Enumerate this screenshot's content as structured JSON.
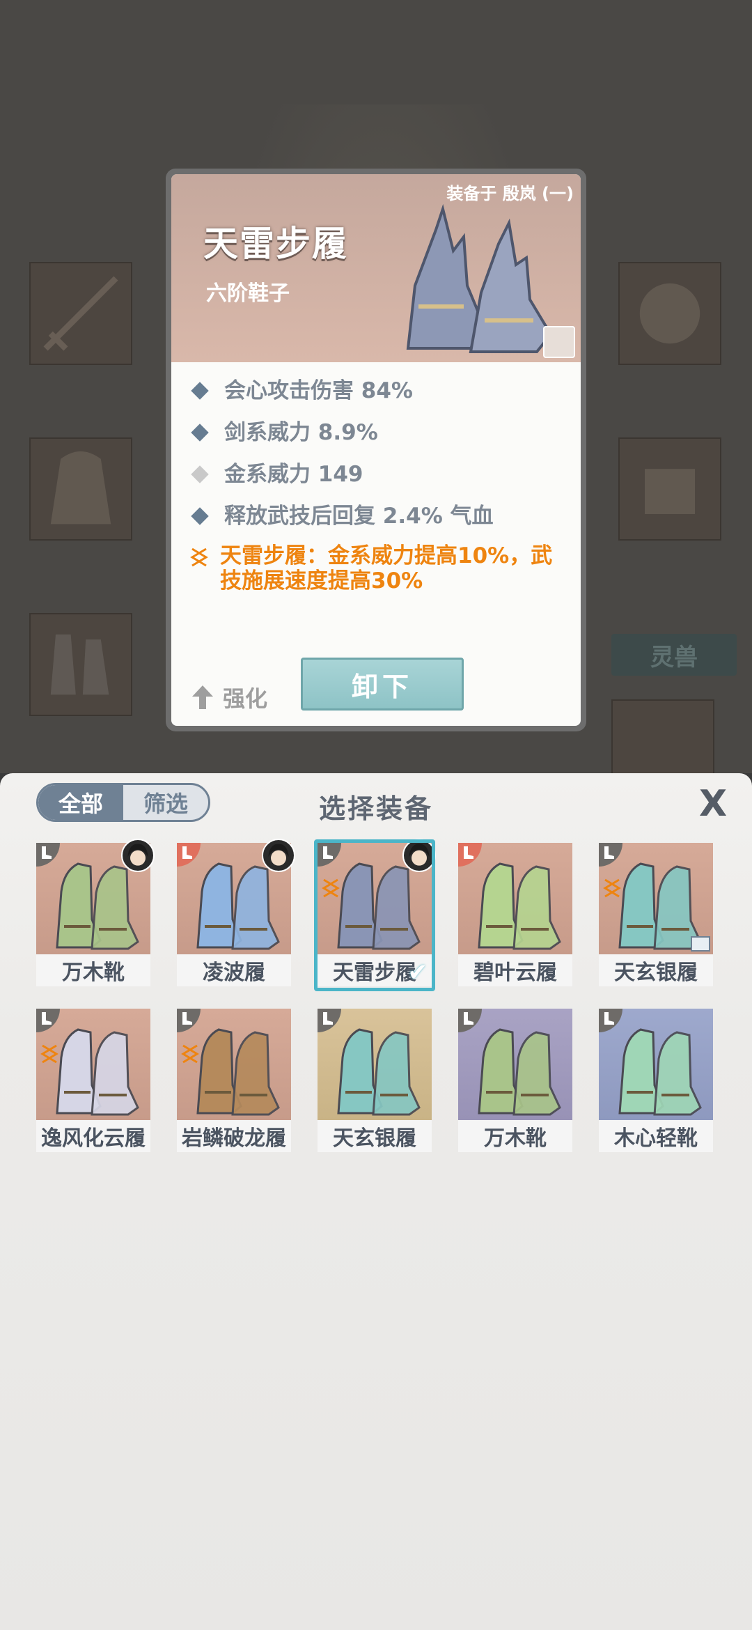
{
  "detail": {
    "equipped_on": "装备于 殷岚 (一)",
    "name": "天雷步履",
    "type": "六阶鞋子",
    "stats": [
      "会心攻击伤害 84%",
      "剑系威力 8.9%",
      "金系威力 149",
      "释放武技后回复 2.4% 气血"
    ],
    "set_bonus_line1": "天雷步履：金系威力提高10%，武",
    "set_bonus_line2": "技施展速度提高30%",
    "enhance_label": "强化",
    "unequip_label": "卸下"
  },
  "background": {
    "pet_tab_label": "灵兽"
  },
  "panel": {
    "filter_all": "全部",
    "filter_screen": "筛选",
    "title": "选择装备",
    "close_label": "X",
    "items": [
      {
        "name": "万木靴",
        "bg": "salmon",
        "color": "#a9c48a",
        "badge": "gray",
        "avatar": true,
        "set": false,
        "tag": false,
        "selected": false
      },
      {
        "name": "凌波履",
        "bg": "salmon",
        "color": "#8fb4e0",
        "badge": "red",
        "avatar": true,
        "set": false,
        "tag": false,
        "selected": false
      },
      {
        "name": "天雷步履",
        "bg": "salmon",
        "color": "#8a95b5",
        "badge": "gray",
        "avatar": true,
        "set": true,
        "tag": false,
        "selected": true
      },
      {
        "name": "碧叶云履",
        "bg": "salmon",
        "color": "#b5d490",
        "badge": "red",
        "avatar": false,
        "set": false,
        "tag": false,
        "selected": false
      },
      {
        "name": "天玄银履",
        "bg": "salmon",
        "color": "#86c7c2",
        "badge": "gray",
        "avatar": false,
        "set": true,
        "tag": true,
        "selected": false
      },
      {
        "name": "逸风化云履",
        "bg": "salmon",
        "color": "#d6d6e6",
        "badge": "gray",
        "avatar": false,
        "set": true,
        "tag": false,
        "selected": false
      },
      {
        "name": "岩鳞破龙履",
        "bg": "salmon",
        "color": "#b58a5c",
        "badge": "gray",
        "avatar": false,
        "set": true,
        "tag": false,
        "selected": false
      },
      {
        "name": "天玄银履",
        "bg": "tan",
        "color": "#86c7c2",
        "badge": "gray",
        "avatar": false,
        "set": false,
        "tag": false,
        "selected": false
      },
      {
        "name": "万木靴",
        "bg": "lilac",
        "color": "#a9c48a",
        "badge": "gray",
        "avatar": false,
        "set": false,
        "tag": false,
        "selected": false
      },
      {
        "name": "木心轻靴",
        "bg": "blue",
        "color": "#9fd6b6",
        "badge": "gray",
        "avatar": false,
        "set": false,
        "tag": false,
        "selected": false
      }
    ]
  },
  "colors": {
    "accent_selected": "#4bb5c8",
    "set_bonus": "#ee8410",
    "stat_text": "#7d8793",
    "badge_red": "#e0705e"
  }
}
